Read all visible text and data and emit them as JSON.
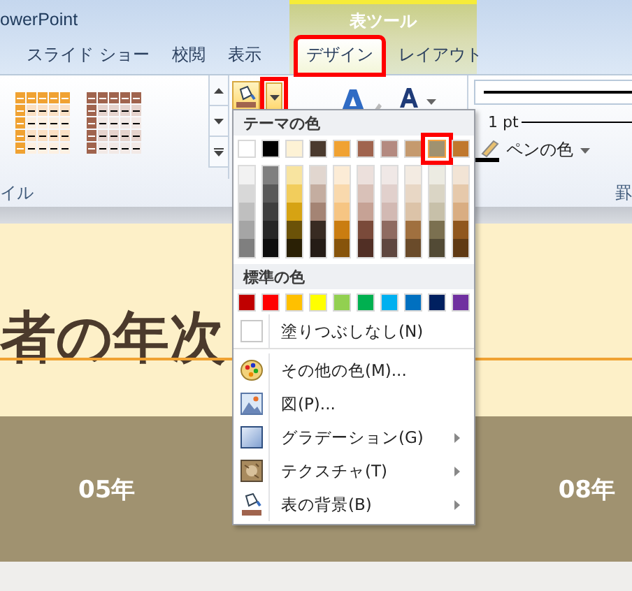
{
  "window": {
    "title": "owerPoint"
  },
  "tabs": [
    {
      "label": "スライド ショー",
      "selected": false
    },
    {
      "label": "校閲",
      "selected": false
    },
    {
      "label": "表示",
      "selected": false
    }
  ],
  "contextual_group": {
    "label": "表ツール",
    "tabs": [
      {
        "label": "デザイン",
        "selected": true,
        "highlighted": true
      },
      {
        "label": "レイアウト",
        "selected": false,
        "highlighted": false
      }
    ]
  },
  "ribbon": {
    "group_labels": [
      "イル",
      "罫"
    ],
    "shading_dropdown": {
      "highlighted": true
    },
    "line_weight": "1 pt",
    "pen_color": "ペンの色"
  },
  "color_menu": {
    "theme_header": "テーマの色",
    "theme_colors": [
      {
        "color": "#ffffff",
        "selected": false,
        "highlighted": false
      },
      {
        "color": "#000000",
        "selected": false,
        "highlighted": false
      },
      {
        "color": "#fdf2d5",
        "selected": false,
        "highlighted": false
      },
      {
        "color": "#4a3a2e",
        "selected": false,
        "highlighted": false
      },
      {
        "color": "#f0a232",
        "selected": false,
        "highlighted": false
      },
      {
        "color": "#a0644e",
        "selected": false,
        "highlighted": false
      },
      {
        "color": "#b48a80",
        "selected": false,
        "highlighted": false
      },
      {
        "color": "#c59a6e",
        "selected": false,
        "highlighted": false
      },
      {
        "color": "#a09270",
        "selected": true,
        "highlighted": true
      },
      {
        "color": "#c0782e",
        "selected": false,
        "highlighted": false
      }
    ],
    "shade_columns": [
      {
        "shades": [
          {
            "color": "#f2f2f2"
          },
          {
            "color": "#d8d8d8"
          },
          {
            "color": "#bfbfbf"
          },
          {
            "color": "#a5a5a5"
          },
          {
            "color": "#7f7f7f"
          }
        ]
      },
      {
        "shades": [
          {
            "color": "#7f7f7f"
          },
          {
            "color": "#595959"
          },
          {
            "color": "#3f3f3f"
          },
          {
            "color": "#262626"
          },
          {
            "color": "#0d0d0d"
          }
        ]
      },
      {
        "shades": [
          {
            "color": "#f8e4a0"
          },
          {
            "color": "#f2cd5c"
          },
          {
            "color": "#d6a313"
          },
          {
            "color": "#6b5208"
          },
          {
            "color": "#2a2005"
          }
        ]
      },
      {
        "shades": [
          {
            "color": "#e1d6cf"
          },
          {
            "color": "#c4ada0"
          },
          {
            "color": "#a48474"
          },
          {
            "color": "#382b22"
          },
          {
            "color": "#251c16"
          }
        ]
      },
      {
        "shades": [
          {
            "color": "#fcecd6"
          },
          {
            "color": "#f9d9ad"
          },
          {
            "color": "#f6c583"
          },
          {
            "color": "#ca7d11"
          },
          {
            "color": "#87540b"
          }
        ]
      },
      {
        "shades": [
          {
            "color": "#ece0dc"
          },
          {
            "color": "#d9c1b8"
          },
          {
            "color": "#c6a295"
          },
          {
            "color": "#7a4a3a"
          },
          {
            "color": "#512f25"
          }
        ]
      },
      {
        "shades": [
          {
            "color": "#f0e8e6"
          },
          {
            "color": "#e1d0cc"
          },
          {
            "color": "#d2b9b3"
          },
          {
            "color": "#8f6b61"
          },
          {
            "color": "#5f4740"
          }
        ]
      },
      {
        "shades": [
          {
            "color": "#f3ebe2"
          },
          {
            "color": "#e8d7c5"
          },
          {
            "color": "#dcc3a8"
          },
          {
            "color": "#a0703f"
          },
          {
            "color": "#6a4b2a"
          }
        ]
      },
      {
        "shades": [
          {
            "color": "#ecebe2"
          },
          {
            "color": "#dad5c5"
          },
          {
            "color": "#c7c0a9"
          },
          {
            "color": "#7b7050"
          },
          {
            "color": "#524a35"
          }
        ]
      },
      {
        "shades": [
          {
            "color": "#f2e4d5"
          },
          {
            "color": "#e6c9ab"
          },
          {
            "color": "#d9ad82"
          },
          {
            "color": "#90571e"
          },
          {
            "color": "#603a14"
          }
        ]
      }
    ],
    "standard_header": "標準の色",
    "standard_colors": [
      {
        "color": "#c00000"
      },
      {
        "color": "#ff0000"
      },
      {
        "color": "#ffc000"
      },
      {
        "color": "#ffff00"
      },
      {
        "color": "#92d050"
      },
      {
        "color": "#00b050"
      },
      {
        "color": "#00b0f0"
      },
      {
        "color": "#0070c0"
      },
      {
        "color": "#002060"
      },
      {
        "color": "#7030a0"
      }
    ],
    "items": [
      {
        "kind": "no-fill",
        "label": "塗りつぶしなし(N)",
        "has_submenu": false
      },
      {
        "kind": "more-colors",
        "label": "その他の色(M)...",
        "has_submenu": false
      },
      {
        "kind": "picture",
        "label": "図(P)...",
        "has_submenu": false
      },
      {
        "kind": "gradient",
        "label": "グラデーション(G)",
        "has_submenu": true
      },
      {
        "kind": "texture",
        "label": "テクスチャ(T)",
        "has_submenu": true
      },
      {
        "kind": "table-background",
        "label": "表の背景(B)",
        "has_submenu": true
      }
    ]
  },
  "slide": {
    "title": "者の年次",
    "header_cells": [
      "05年",
      "08年"
    ]
  }
}
